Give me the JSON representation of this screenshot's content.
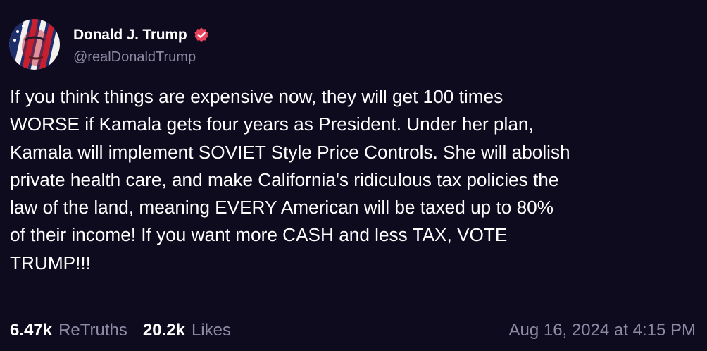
{
  "post": {
    "author": {
      "display_name": "Donald J. Trump",
      "handle": "@realDonaldTrump",
      "verified": true,
      "verified_icon": "verified-badge-icon",
      "avatar": "avatar-flag-face"
    },
    "text": "If you think things are expensive now, they will get 100 times\nWORSE if Kamala gets four years as President. Under her plan,\nKamala will implement SOVIET Style Price Controls. She will abolish\nprivate health care, and make California's ridiculous tax policies the\nlaw of the land, meaning EVERY American will be taxed up to 80%\nof their income! If you want more CASH and less TAX, VOTE\nTRUMP!!!",
    "stats": {
      "retruths_count": "6.47k",
      "retruths_label": "ReTruths",
      "likes_count": "20.2k",
      "likes_label": "Likes"
    },
    "timestamp": "Aug 16, 2024 at 4:15 PM"
  },
  "colors": {
    "background": "#0e0b1f",
    "text": "#ffffff",
    "muted": "#8f8aa3",
    "verified": "#e8455d"
  }
}
